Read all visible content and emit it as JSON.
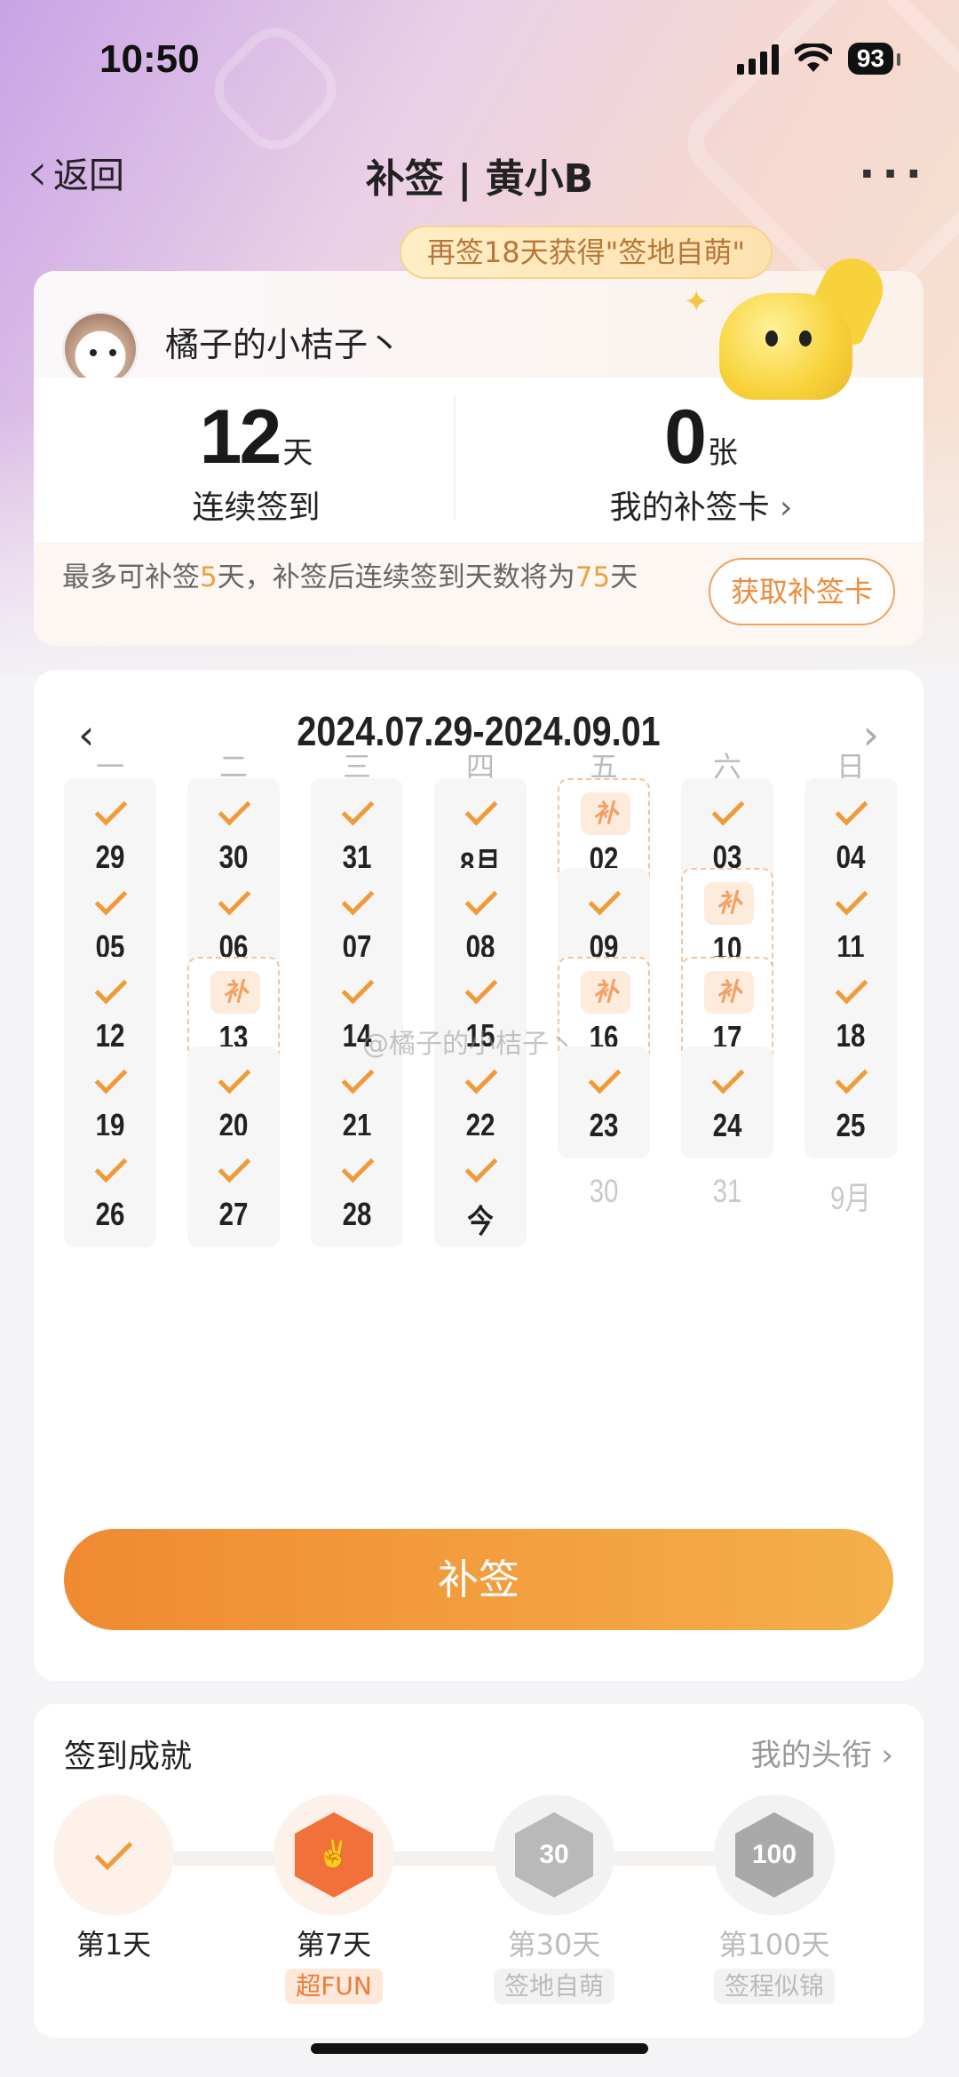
{
  "status": {
    "time": "10:50",
    "battery": "93"
  },
  "nav": {
    "back_label": "返回",
    "title": "补签 | 黄小B",
    "more": "···"
  },
  "banner": "再签18天获得\"签地自萌\"",
  "user": {
    "name": "橘子的小桔子丶"
  },
  "stats": {
    "streak_value": "12",
    "streak_unit": "天",
    "streak_label": "连续签到",
    "cards_value": "0",
    "cards_unit": "张",
    "cards_label": "我的补签卡",
    "cards_chevron": "›"
  },
  "info": {
    "prefix": "最多可补签",
    "max_days": "5",
    "middle": "天，补签后连续签到天数将为",
    "result_days": "75",
    "suffix": "天",
    "button": "获取补签卡"
  },
  "calendar": {
    "range": "2024.07.29-2024.09.01",
    "prev": "‹",
    "next": "›",
    "weekdays": [
      "一",
      "二",
      "三",
      "四",
      "五",
      "六",
      "日"
    ],
    "makeup_tag": "补",
    "cells": [
      {
        "label": "29",
        "state": "signed"
      },
      {
        "label": "30",
        "state": "signed"
      },
      {
        "label": "31",
        "state": "signed"
      },
      {
        "label": "8月",
        "state": "signed"
      },
      {
        "label": "02",
        "state": "makeup"
      },
      {
        "label": "03",
        "state": "signed"
      },
      {
        "label": "04",
        "state": "signed"
      },
      {
        "label": "05",
        "state": "signed"
      },
      {
        "label": "06",
        "state": "signed"
      },
      {
        "label": "07",
        "state": "signed"
      },
      {
        "label": "08",
        "state": "signed"
      },
      {
        "label": "09",
        "state": "signed"
      },
      {
        "label": "10",
        "state": "makeup"
      },
      {
        "label": "11",
        "state": "signed"
      },
      {
        "label": "12",
        "state": "signed"
      },
      {
        "label": "13",
        "state": "makeup"
      },
      {
        "label": "14",
        "state": "signed"
      },
      {
        "label": "15",
        "state": "signed"
      },
      {
        "label": "16",
        "state": "makeup"
      },
      {
        "label": "17",
        "state": "makeup"
      },
      {
        "label": "18",
        "state": "signed"
      },
      {
        "label": "19",
        "state": "signed"
      },
      {
        "label": "20",
        "state": "signed"
      },
      {
        "label": "21",
        "state": "signed"
      },
      {
        "label": "22",
        "state": "signed"
      },
      {
        "label": "23",
        "state": "signed"
      },
      {
        "label": "24",
        "state": "signed"
      },
      {
        "label": "25",
        "state": "signed"
      },
      {
        "label": "26",
        "state": "signed"
      },
      {
        "label": "27",
        "state": "signed"
      },
      {
        "label": "28",
        "state": "signed"
      },
      {
        "label": "今",
        "state": "signed"
      },
      {
        "label": "30",
        "state": "future"
      },
      {
        "label": "31",
        "state": "future"
      },
      {
        "label": "9月",
        "state": "future"
      }
    ],
    "watermark": "@橘子的小桔子丶",
    "button": "补签"
  },
  "achievements": {
    "title": "签到成就",
    "link": "我的头衔",
    "link_chevron": "›",
    "items": [
      {
        "day": "第1天",
        "tag": "",
        "state": "done"
      },
      {
        "day": "第7天",
        "tag": "超FUN",
        "state": "active",
        "badge_text": "",
        "color": "#f2713a"
      },
      {
        "day": "第30天",
        "tag": "签地自萌",
        "state": "locked",
        "badge_text": "30",
        "color": "#b9b9b9"
      },
      {
        "day": "第100天",
        "tag": "签程似锦",
        "state": "locked",
        "badge_text": "100",
        "color": "#a9a9a9"
      }
    ]
  },
  "colors": {
    "accent": "#f08a32",
    "accent_end": "#f4b04a",
    "makeup_border": "#f7c29a"
  }
}
